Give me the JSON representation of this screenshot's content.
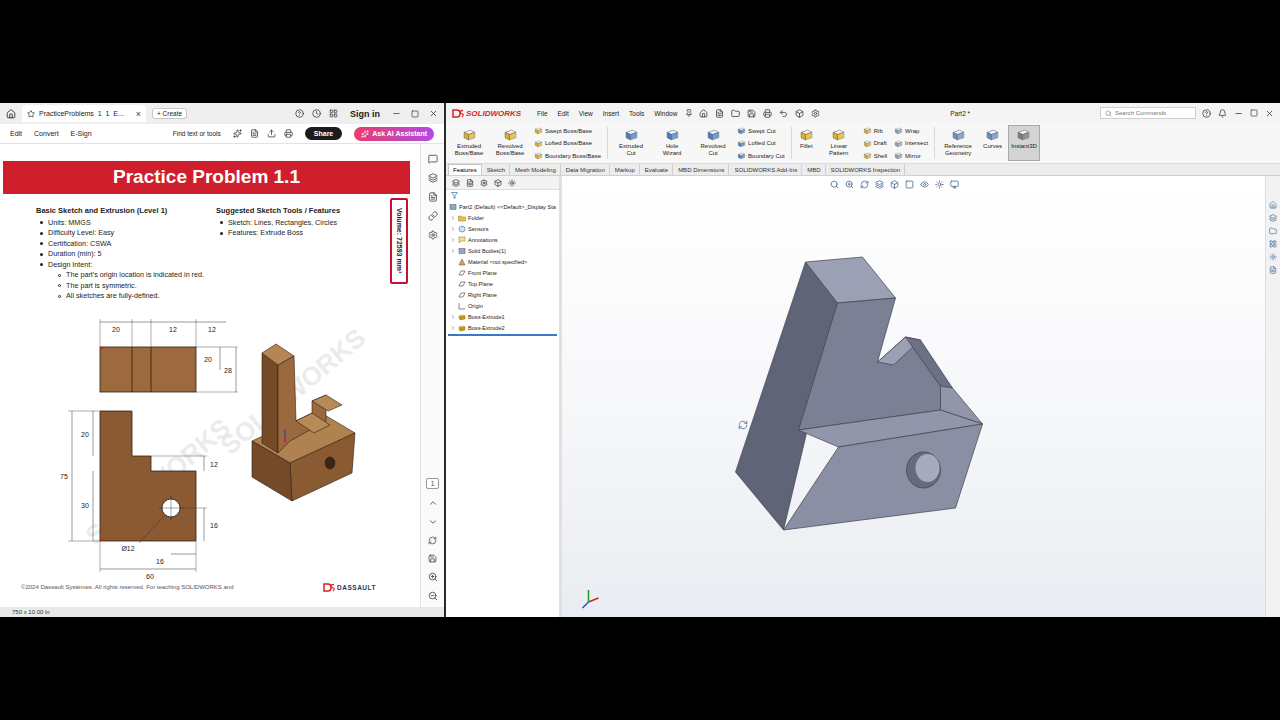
{
  "pdf_viewer": {
    "tab": {
      "title": "PracticeProblems_1_1_E...",
      "close": "×",
      "starred": false
    },
    "new_button": "+ Create",
    "sign_in": "Sign in",
    "toolbar": {
      "items": [
        "Edit",
        "Convert",
        "E-Sign"
      ],
      "find": "Find text or tools",
      "share": "Share",
      "ai": "Ask AI Assistant"
    },
    "document": {
      "title": "Practice Problem 1.1",
      "left_heading": "Basic Sketch and Extrusion (Level 1)",
      "bullets": [
        "Units: MMGS",
        "Difficulty Level: Easy",
        "Certification: CSWA",
        "Duration (min): 5",
        "Design Intent:"
      ],
      "sub_bullets": [
        "The part's origin location is indicated in red.",
        "The part is symmetric.",
        "All sketches are fully-defined."
      ],
      "right_heading": "Suggested Sketch Tools / Features",
      "right_bullets": [
        "Sketch: Lines, Rectangles, Circles",
        "Features: Extrude Boss"
      ],
      "volume": "Volume: 72593 mm³",
      "dimension_labels": [
        "20",
        "12",
        "12",
        "20",
        "28",
        "75",
        "20",
        "30",
        "12",
        "16",
        "Ø12",
        "16",
        "60"
      ],
      "watermark": "SOLIDWORKS",
      "footer": "©2024 Dassault Systèmes. All rights reserved. For teaching SOLIDWORKS and",
      "footer_logo": "DASSAULT"
    },
    "page_size": "750 x 10.00 in",
    "page_number": "1"
  },
  "solidworks": {
    "logo": "SOLIDWORKS",
    "menu": [
      "File",
      "Edit",
      "View",
      "Insert",
      "Tools",
      "Window"
    ],
    "document_title": "Part2 *",
    "search_placeholder": "Search Commands",
    "ribbon": [
      {
        "kind": "large",
        "items": [
          {
            "label": "Extruded Boss/Base",
            "active": false
          }
        ]
      },
      {
        "kind": "large",
        "items": [
          {
            "label": "Revolved Boss/Base",
            "active": false
          }
        ]
      },
      {
        "kind": "stack",
        "items": [
          {
            "label": "Swept Boss/Base",
            "active": false
          },
          {
            "label": "Lofted Boss/Base",
            "active": false
          },
          {
            "label": "Boundary Boss/Base",
            "active": false
          }
        ]
      },
      {
        "kind": "large",
        "items": [
          {
            "label": "Extruded Cut",
            "active": false
          }
        ]
      },
      {
        "kind": "large",
        "items": [
          {
            "label": "Hole Wizard",
            "active": false
          }
        ]
      },
      {
        "kind": "large",
        "items": [
          {
            "label": "Revolved Cut",
            "active": false
          }
        ]
      },
      {
        "kind": "stack",
        "items": [
          {
            "label": "Swept Cut",
            "active": false
          },
          {
            "label": "Lofted Cut",
            "active": false
          },
          {
            "label": "Boundary Cut",
            "active": false
          }
        ]
      },
      {
        "kind": "large",
        "items": [
          {
            "label": "Fillet",
            "active": false
          }
        ]
      },
      {
        "kind": "large",
        "items": [
          {
            "label": "Linear Pattern",
            "active": false
          }
        ]
      },
      {
        "kind": "stack",
        "items": [
          {
            "label": "Rib",
            "active": false
          },
          {
            "label": "Draft",
            "active": false
          },
          {
            "label": "Shell",
            "active": false
          }
        ]
      },
      {
        "kind": "stack",
        "items": [
          {
            "label": "Wrap",
            "active": false
          },
          {
            "label": "Intersect",
            "active": false
          },
          {
            "label": "Mirror",
            "active": false
          }
        ]
      },
      {
        "kind": "large",
        "items": [
          {
            "label": "Reference Geometry",
            "active": false
          }
        ]
      },
      {
        "kind": "large",
        "items": [
          {
            "label": "Curves",
            "active": false
          }
        ]
      },
      {
        "kind": "large",
        "items": [
          {
            "label": "Instant3D",
            "active": true
          }
        ]
      }
    ],
    "tabs": [
      {
        "label": "Features",
        "selected": true
      },
      {
        "label": "Sketch",
        "selected": false
      },
      {
        "label": "Mesh Modeling",
        "selected": false
      },
      {
        "label": "Data Migration",
        "selected": false
      },
      {
        "label": "Markup",
        "selected": false
      },
      {
        "label": "Evaluate",
        "selected": false
      },
      {
        "label": "MBD Dimensions",
        "selected": false
      },
      {
        "label": "SOLIDWORKS Add-Ins",
        "selected": false
      },
      {
        "label": "MBD",
        "selected": false
      },
      {
        "label": "SOLIDWORKS Inspection",
        "selected": false
      }
    ],
    "tree": {
      "root": "Part2 (Default) <<Default>_Display Sta",
      "items": [
        {
          "label": "Folder",
          "expandable": true
        },
        {
          "label": "Sensors",
          "expandable": true
        },
        {
          "label": "Annotations",
          "expandable": true
        },
        {
          "label": "Solid Bodies(1)",
          "expandable": true
        },
        {
          "label": "Material <not specified>",
          "expandable": false
        },
        {
          "label": "Front Plane",
          "expandable": false
        },
        {
          "label": "Top Plane",
          "expandable": false
        },
        {
          "label": "Right Plane",
          "expandable": false
        },
        {
          "label": "Origin",
          "expandable": false
        },
        {
          "label": "Boss-Extrude1",
          "expandable": true
        },
        {
          "label": "Boss-Extrude2",
          "expandable": true
        }
      ]
    }
  }
}
